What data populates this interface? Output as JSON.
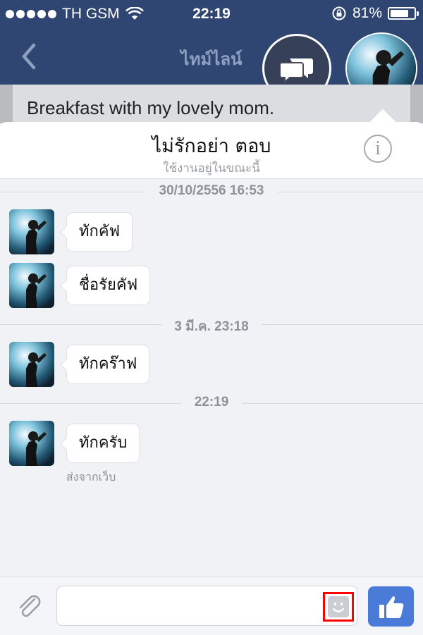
{
  "status": {
    "carrier": "TH GSM",
    "time": "22:19",
    "battery_text": "81%",
    "battery_level": 0.81
  },
  "nav": {
    "title": "ไทม์ไลน์"
  },
  "background": {
    "post_text": "Breakfast with my lovely mom."
  },
  "chat": {
    "name": "ไม่รักอย่า ตอบ",
    "status": "ใช้งานอยู่ในขณะนี้"
  },
  "dividers": [
    "30/10/2556 16:53",
    "3 มี.ค. 23:18",
    "22:19"
  ],
  "messages": [
    "ทักคัฟ",
    "ชื่อรัยคัฟ",
    "ทักคร๊าฟ",
    "ทักครับ"
  ],
  "sent_from": "ส่งจากเว็บ",
  "input": {
    "value": ""
  },
  "colors": {
    "header_bg": "#2f4672",
    "like_button": "#4a7bd8",
    "panel_bg": "#f1f2f6"
  },
  "icons": [
    "back-chevron-icon",
    "chat-bubbles-icon",
    "info-icon",
    "paperclip-icon",
    "emoji-icon",
    "thumbs-up-icon"
  ]
}
